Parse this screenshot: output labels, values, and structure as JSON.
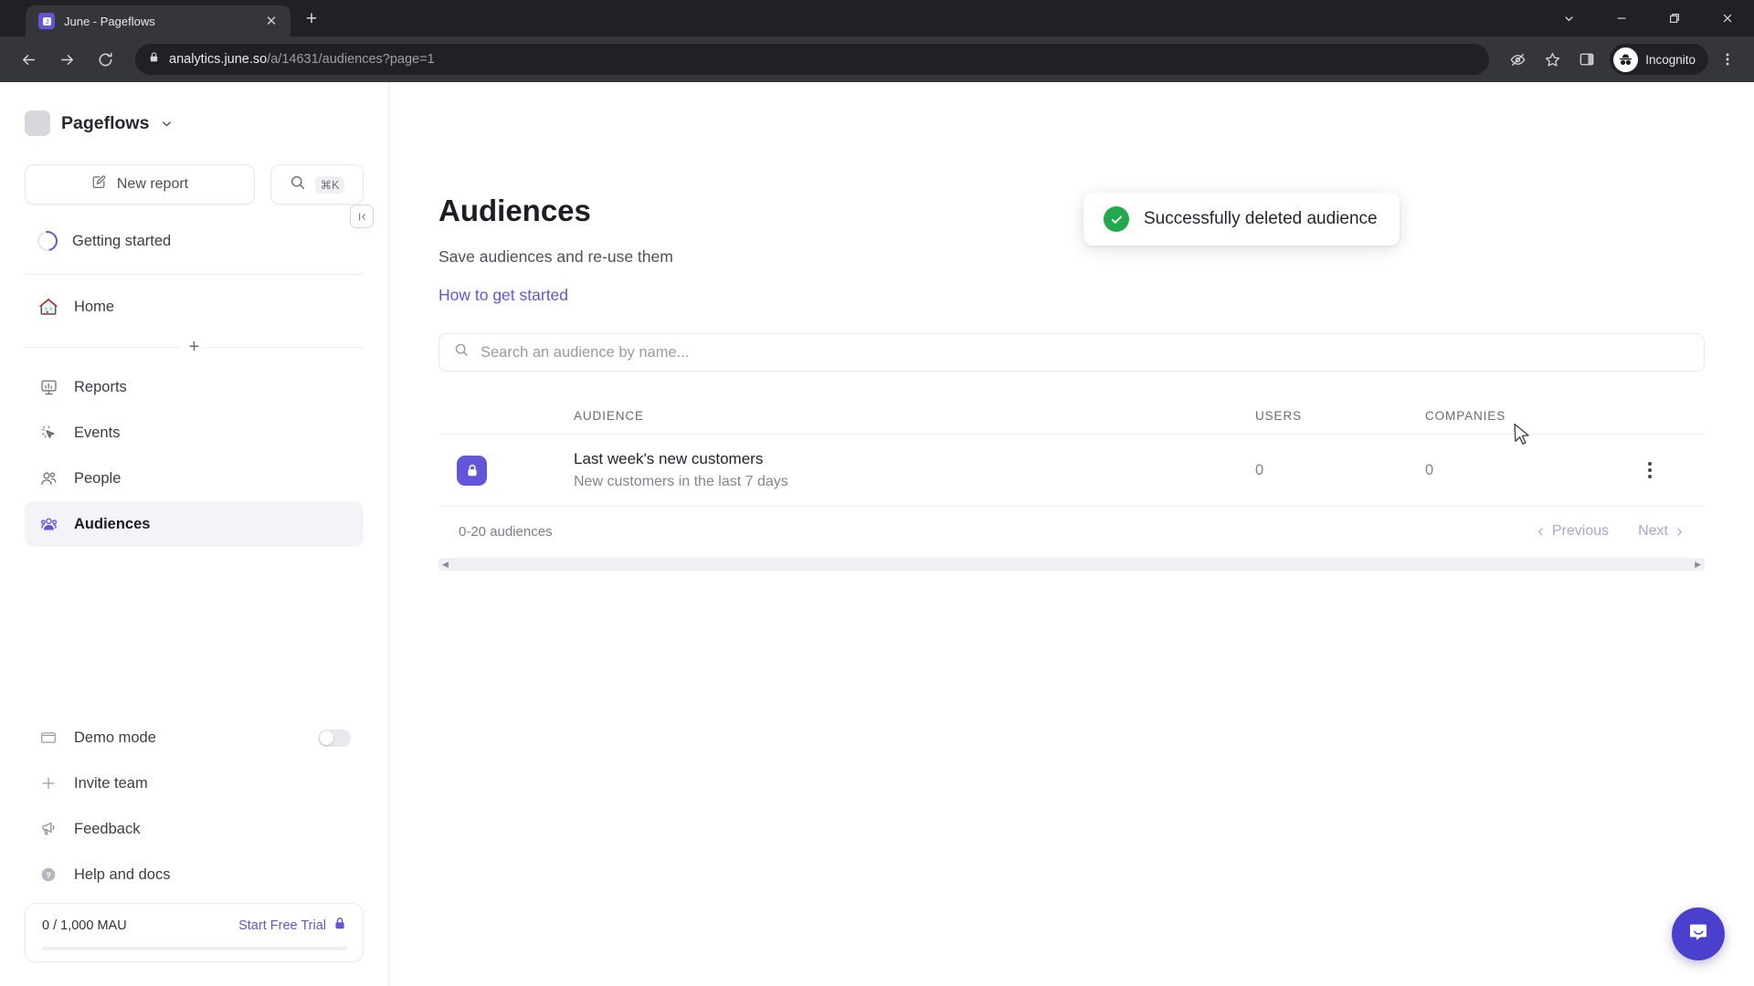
{
  "browser": {
    "tab": {
      "title": "June - Pageflows",
      "favicon_icon": "june-logo-icon",
      "close_icon": "close-icon"
    },
    "new_tab_icon": "plus-icon",
    "window_controls": [
      {
        "name": "chevron-down-icon",
        "glyph": "⌄"
      },
      {
        "name": "minimize-icon",
        "glyph": "—"
      },
      {
        "name": "maximize-icon",
        "glyph": "❐"
      },
      {
        "name": "close-window-icon",
        "glyph": "✕"
      }
    ],
    "nav": {
      "back_icon": "back-arrow-icon",
      "forward_icon": "forward-arrow-icon",
      "reload_icon": "reload-icon"
    },
    "omnibox": {
      "lock_icon": "lock-icon",
      "host": "analytics.june.so",
      "path": "/a/14631/audiences?page=1"
    },
    "toolbar_icons": [
      {
        "name": "tracking-protection-icon"
      },
      {
        "name": "bookmark-star-icon"
      },
      {
        "name": "side-panel-icon"
      }
    ],
    "profile": {
      "label": "Incognito",
      "icon": "incognito-icon"
    },
    "menu_icon": "three-dot-menu-icon"
  },
  "sidebar": {
    "workspace": {
      "name": "Pageflows",
      "chevron_icon": "chevron-down-icon",
      "logo_icon": "workspace-logo"
    },
    "collapse_icon": "collapse-sidebar-icon",
    "new_report": {
      "label": "New report",
      "icon": "edit-pencil-icon"
    },
    "search": {
      "icon": "search-icon",
      "shortcut": "⌘K"
    },
    "getting_started": {
      "label": "Getting started",
      "icon": "progress-ring-icon"
    },
    "primary_items": [
      {
        "label": "Home",
        "icon": "home-icon",
        "active": false
      }
    ],
    "section_add_icon": "plus-icon",
    "nav_items": [
      {
        "label": "Reports",
        "icon": "reports-icon",
        "active": false
      },
      {
        "label": "Events",
        "icon": "events-cursor-icon",
        "active": false
      },
      {
        "label": "People",
        "icon": "people-icon",
        "active": false
      },
      {
        "label": "Audiences",
        "icon": "audiences-icon",
        "active": true
      }
    ],
    "lower_items": [
      {
        "label": "Demo mode",
        "icon": "demo-mode-icon",
        "toggle": true,
        "toggle_on": false
      },
      {
        "label": "Invite team",
        "icon": "plus-icon",
        "toggle": false
      },
      {
        "label": "Feedback",
        "icon": "megaphone-icon",
        "toggle": false
      },
      {
        "label": "Help and docs",
        "icon": "help-circle-icon",
        "toggle": false
      }
    ],
    "mau": {
      "count": "0 / 1,000 MAU",
      "cta": "Start Free Trial",
      "lock_icon": "lock-icon",
      "progress_percent": 0
    }
  },
  "toast": {
    "message": "Successfully deleted audience",
    "icon": "success-check-icon",
    "accent": "#22a94f"
  },
  "main": {
    "title": "Audiences",
    "subtitle": "Save audiences and re-use them",
    "help_link": "How to get started",
    "search": {
      "placeholder": "Search an audience by name...",
      "value": "",
      "icon": "search-icon"
    },
    "table": {
      "columns": [
        "AUDIENCE",
        "USERS",
        "COMPANIES"
      ],
      "rows": [
        {
          "icon": "lock-icon",
          "name": "Last week's new customers",
          "description": "New customers in the last 7 days",
          "users": "0",
          "companies": "0",
          "menu_icon": "kebab-menu-icon"
        }
      ],
      "footer": {
        "count": "0-20 audiences",
        "previous": "Previous",
        "next": "Next",
        "prev_icon": "chevron-left-icon",
        "next_icon": "chevron-right-icon"
      }
    }
  },
  "intercom": {
    "icon": "intercom-chat-icon",
    "color": "#4b40cc"
  },
  "theme": {
    "accent": "#6355d9",
    "link": "#6355d9",
    "success": "#22a94f"
  }
}
